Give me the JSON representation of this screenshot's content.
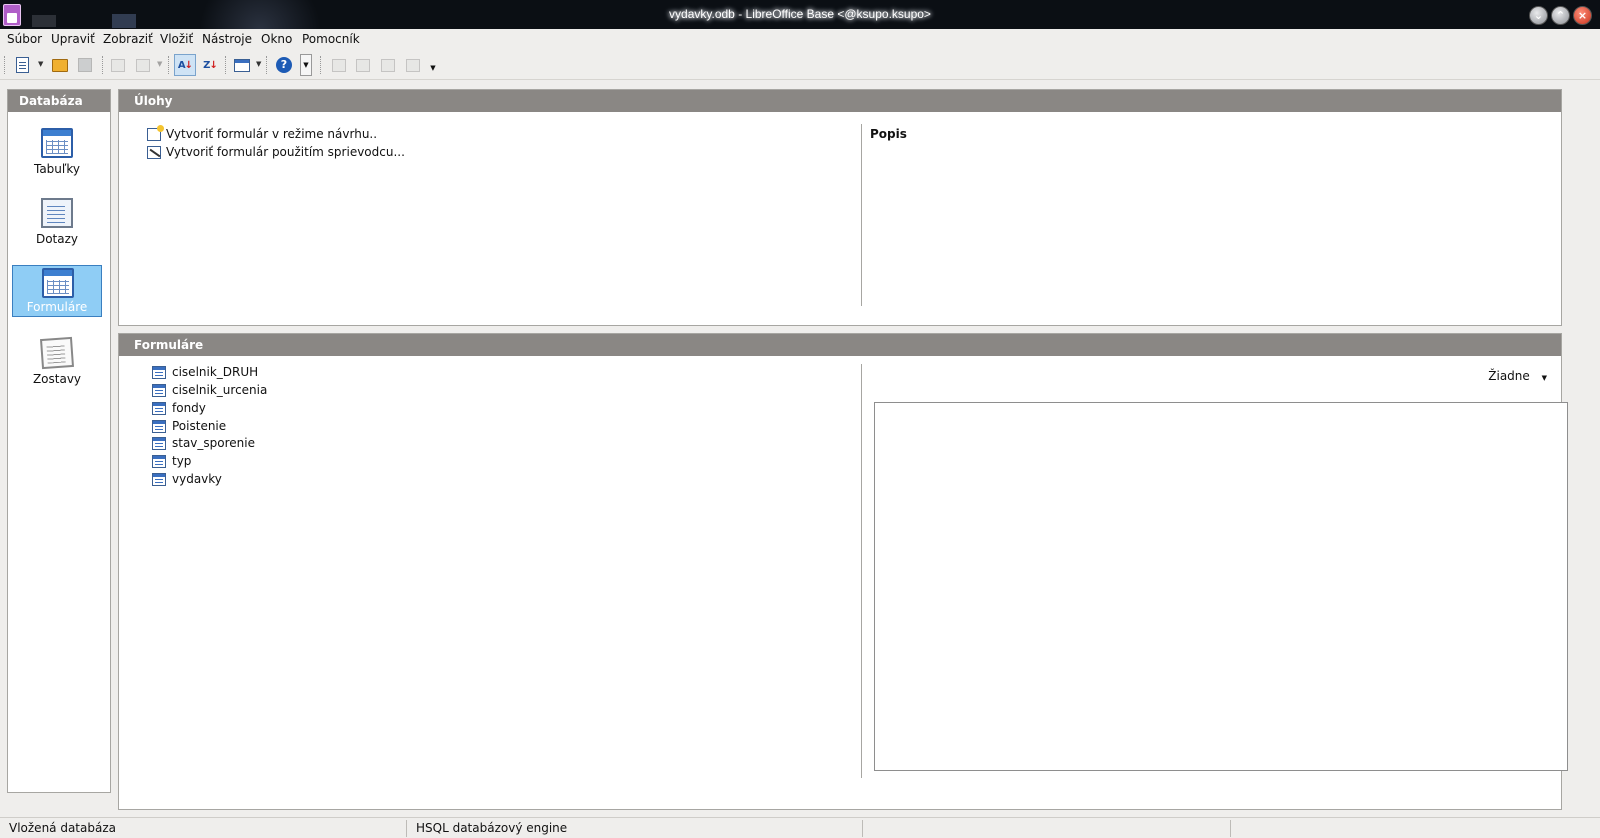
{
  "window": {
    "title": "vydavky.odb - LibreOffice Base <@ksupo.ksupo>",
    "controls": [
      "minimize",
      "maximize",
      "close"
    ]
  },
  "menu": {
    "items": [
      "Súbor",
      "Upraviť",
      "Zobraziť",
      "Vložiť",
      "Nástroje",
      "Okno",
      "Pomocník"
    ]
  },
  "toolbar": {
    "icons": [
      "new-document-icon",
      "open-icon",
      "save-icon",
      "copy-icon",
      "paste-icon",
      "sort-ascending-icon",
      "sort-descending-icon",
      "new-form-icon",
      "help-icon",
      "open-object-icon",
      "edit-icon",
      "rename-icon",
      "delete-icon"
    ]
  },
  "left_pane": {
    "header": "Databáza",
    "items": [
      {
        "label": "Tabuľky",
        "icon": "table-icon"
      },
      {
        "label": "Dotazy",
        "icon": "query-icon"
      },
      {
        "label": "Formuláre",
        "icon": "form-icon",
        "selected": true
      },
      {
        "label": "Zostavy",
        "icon": "report-icon"
      }
    ]
  },
  "tasks_pane": {
    "header": "Úlohy",
    "tasks": [
      "Vytvoriť formulár v režime návrhu..",
      "Vytvoriť formulár použitím sprievodcu..."
    ],
    "description_label": "Popis"
  },
  "forms_pane": {
    "header": "Formuláre",
    "forms": [
      "ciselnik_DRUH",
      "ciselnik_urcenia",
      "fondy",
      "Poistenie",
      "stav_sporenie",
      "typ",
      "vydavky"
    ],
    "preview_mode": "Žiadne"
  },
  "statusbar": {
    "left": "Vložená databáza",
    "engine": "HSQL databázový engine"
  },
  "colors": {
    "header_bg": "#8a8784",
    "selected_bg": "#8fcdf5",
    "accent_blue": "#2c5ea8"
  }
}
